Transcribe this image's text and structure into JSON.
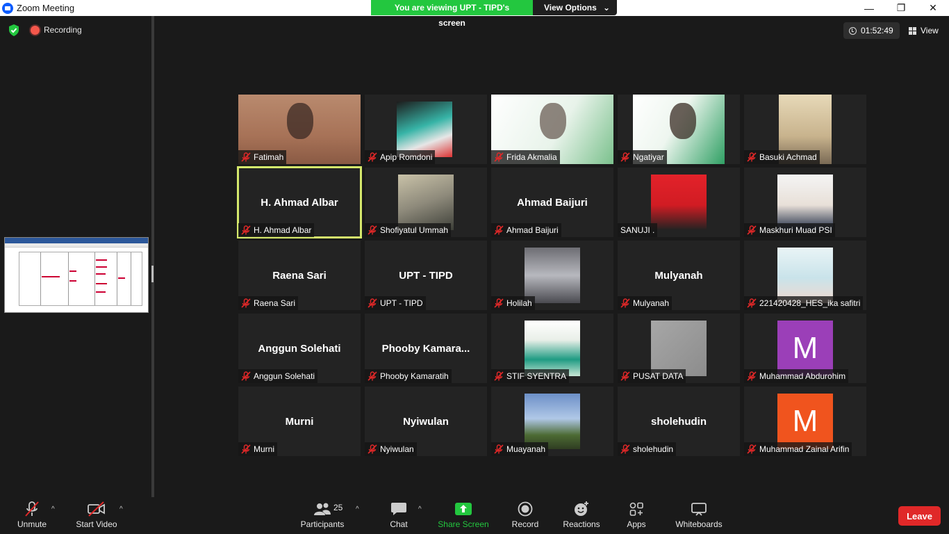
{
  "window": {
    "title": "Zoom Meeting",
    "minimize_glyph": "—",
    "restore_glyph": "❐",
    "close_glyph": "✕"
  },
  "banner": {
    "text": "You are viewing UPT - TIPD's screen",
    "options_label": "View Options",
    "options_caret": "⌄"
  },
  "recording": {
    "label": "Recording"
  },
  "timer": {
    "value": "01:52:49"
  },
  "view": {
    "label": "View"
  },
  "colors": {
    "green": "#23c73f",
    "leave": "#e02828",
    "active_speaker": "#d5e86c",
    "muted_icon": "#e02828",
    "avatar_purple": "#9b3fb8",
    "avatar_orange": "#f0541e"
  },
  "participants": [
    {
      "name": "Fatimah",
      "type": "video"
    },
    {
      "name": "Apip Romdoni",
      "type": "photo"
    },
    {
      "name": "Frida Akmalia",
      "type": "video"
    },
    {
      "name": "Ngatiyar",
      "type": "video"
    },
    {
      "name": "Basuki Achmad",
      "type": "photo"
    },
    {
      "name": "H. Ahmad Albar",
      "type": "name",
      "display": "H. Ahmad Albar",
      "active": true
    },
    {
      "name": "Shofiyatul Ummah",
      "type": "photo"
    },
    {
      "name": "Ahmad Baijuri",
      "type": "name",
      "display": "Ahmad Baijuri"
    },
    {
      "name": "SANUJI .",
      "type": "photo",
      "unmuted": true
    },
    {
      "name": "Maskhuri Muad PSI",
      "type": "photo"
    },
    {
      "name": "Raena Sari",
      "type": "name",
      "display": "Raena Sari"
    },
    {
      "name": "UPT - TIPD",
      "type": "name",
      "display": "UPT - TIPD"
    },
    {
      "name": "Holilah",
      "type": "photo"
    },
    {
      "name": "Mulyanah",
      "type": "name",
      "display": "Mulyanah"
    },
    {
      "name": "221420428_HES_ika safitri",
      "type": "photo"
    },
    {
      "name": "Anggun Solehati",
      "type": "name",
      "display": "Anggun Solehati"
    },
    {
      "name": "Phooby Kamaratih",
      "type": "name",
      "display": "Phooby  Kamara..."
    },
    {
      "name": "STIF SYENTRA",
      "type": "photo"
    },
    {
      "name": "PUSAT DATA",
      "type": "photo"
    },
    {
      "name": "Muhammad Abdurohim",
      "type": "letter",
      "letter": "M",
      "color": "#9b3fb8"
    },
    {
      "name": "Murni",
      "type": "name",
      "display": "Murni"
    },
    {
      "name": "Nyiwulan",
      "type": "name",
      "display": "Nyiwulan"
    },
    {
      "name": "Muayanah",
      "type": "photo"
    },
    {
      "name": "sholehudin",
      "type": "name",
      "display": "sholehudin"
    },
    {
      "name": "Muhammad Zainal Arifin",
      "type": "letter",
      "letter": "M",
      "color": "#f0541e"
    }
  ],
  "toolbar": {
    "unmute": "Unmute",
    "start_video": "Start Video",
    "participants": "Participants",
    "participants_count": "25",
    "chat": "Chat",
    "share_screen": "Share Screen",
    "record": "Record",
    "reactions": "Reactions",
    "apps": "Apps",
    "whiteboards": "Whiteboards",
    "leave": "Leave",
    "caret": "^"
  }
}
